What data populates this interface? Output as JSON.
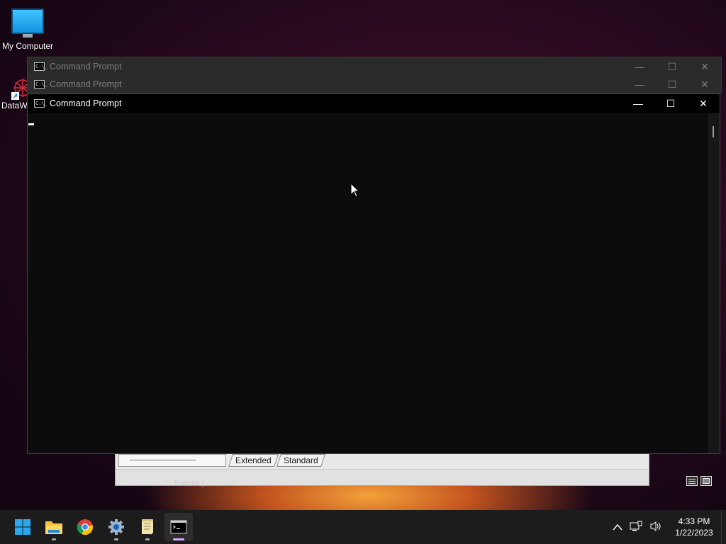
{
  "desktop": {
    "icons": [
      {
        "label": "My Computer"
      },
      {
        "label": "DataW"
      }
    ]
  },
  "background_window": {
    "tabs": [
      "Extended",
      "Standard"
    ],
    "status_text": "0 items |"
  },
  "command_windows": [
    {
      "title": "Command Prompt",
      "state": "inactive"
    },
    {
      "title": "Command Prompt",
      "state": "inactive"
    },
    {
      "title": "Command Prompt",
      "state": "active"
    }
  ],
  "window_controls": {
    "minimize": "—",
    "maximize": "☐",
    "close": "✕"
  },
  "cmd_icon_text": "C:\\_",
  "taskbar": {
    "apps": [
      {
        "name": "start",
        "icon": "windows-logo-icon"
      },
      {
        "name": "file-explorer",
        "icon": "folder-icon"
      },
      {
        "name": "chrome",
        "icon": "chrome-icon"
      },
      {
        "name": "settings",
        "icon": "gear-icon"
      },
      {
        "name": "notepad",
        "icon": "notepad-icon"
      },
      {
        "name": "command-prompt",
        "icon": "terminal-icon",
        "active": true
      }
    ],
    "tray": {
      "time": "4:33 PM",
      "date": "1/22/2023"
    }
  },
  "colors": {
    "console_bg": "#0c0c0c",
    "taskbar_bg": "#1c1c1c",
    "active_indicator": "#d8a6ff"
  }
}
